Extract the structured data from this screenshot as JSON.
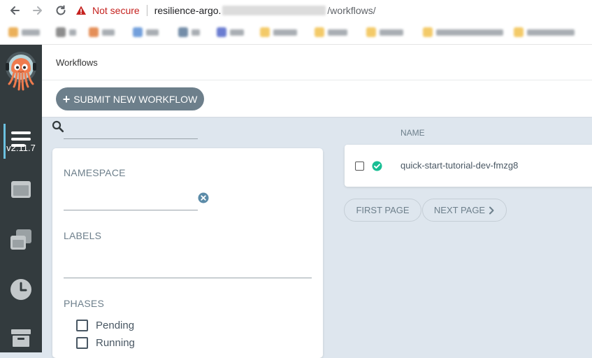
{
  "browser": {
    "not_secure_label": "Not secure",
    "url_host": "resilience-argo.",
    "url_path": "/workflows/"
  },
  "sidebar": {
    "version": "v2.11.7",
    "nav_icons": [
      "workflows-icon",
      "workflow-templates-icon",
      "cluster-templates-icon",
      "cron-workflows-icon",
      "archived-workflows-icon"
    ],
    "accent": "#6bc1e0"
  },
  "header": {
    "title": "Workflows"
  },
  "toolbar": {
    "submit_label": "SUBMIT NEW WORKFLOW"
  },
  "filters": {
    "search_value": "",
    "namespace_label": "NAMESPACE",
    "namespace_value": "",
    "labels_label": "LABELS",
    "labels_value": "",
    "phases_label": "PHASES",
    "phases": [
      {
        "label": "Pending",
        "checked": false
      },
      {
        "label": "Running",
        "checked": false
      }
    ]
  },
  "workflows": {
    "column_name": "NAME",
    "rows": [
      {
        "name": "quick-start-tutorial-dev-fmzg8",
        "status": "succeeded",
        "status_color": "#18be94"
      }
    ]
  },
  "pagination": {
    "first_label": "FIRST PAGE",
    "next_label": "NEXT PAGE"
  },
  "colors": {
    "sidebar_bg": "#333b3e",
    "content_bg": "#dee6ee",
    "button_bg": "#6d7f8b",
    "warning_red": "#c5221f"
  }
}
